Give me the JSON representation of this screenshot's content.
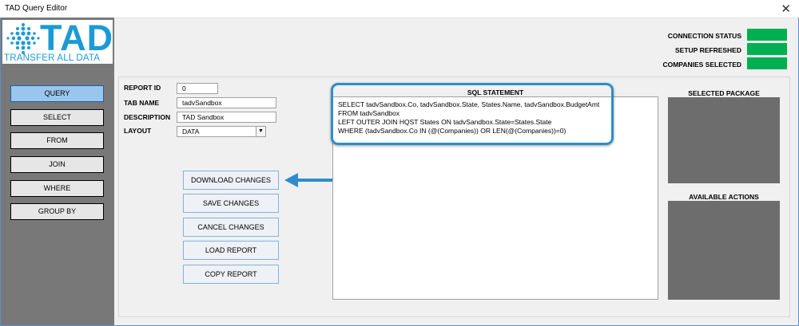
{
  "window": {
    "title": "TAD Query Editor",
    "close_glyph": "✕"
  },
  "logo": {
    "name": "TAD",
    "tagline": "TRANSFER ALL DATA",
    "brand_color": "#1c9ad6"
  },
  "nav": {
    "items": [
      {
        "label": "QUERY",
        "active": true
      },
      {
        "label": "SELECT",
        "active": false
      },
      {
        "label": "FROM",
        "active": false
      },
      {
        "label": "JOIN",
        "active": false
      },
      {
        "label": "WHERE",
        "active": false
      },
      {
        "label": "GROUP BY",
        "active": false
      }
    ]
  },
  "status": {
    "items": [
      {
        "label": "CONNECTION STATUS",
        "color": "#00b050"
      },
      {
        "label": "SETUP REFRESHED",
        "color": "#00b050"
      },
      {
        "label": "COMPANIES SELECTED",
        "color": "#00b050"
      }
    ]
  },
  "form": {
    "report_id": {
      "label": "REPORT ID",
      "value": "0"
    },
    "tab_name": {
      "label": "TAB NAME",
      "value": "tadvSandbox"
    },
    "description": {
      "label": "DESCRIPTION",
      "value": "TAD Sandbox"
    },
    "layout": {
      "label": "LAYOUT",
      "value": "DATA"
    }
  },
  "actions": {
    "download": "DOWNLOAD CHANGES",
    "save": "SAVE CHANGES",
    "cancel": "CANCEL CHANGES",
    "load": "LOAD REPORT",
    "copy": "COPY REPORT"
  },
  "sql": {
    "label": "SQL STATEMENT",
    "lines": [
      "SELECT tadvSandbox.Co, tadvSandbox.State, States.Name, tadvSandbox.BudgetAmt",
      "FROM tadvSandbox",
      "LEFT OUTER JOIN HQST States ON tadvSandbox.State=States.State",
      "WHERE (tadvSandbox.Co IN (@(Companies)) OR LEN(@(Companies))=0)"
    ]
  },
  "right_panels": {
    "selected_package": "SELECTED PACKAGE",
    "available_actions": "AVAILABLE ACTIONS"
  },
  "colors": {
    "left_panel": "#787878",
    "active_nav": "#9ac6ee",
    "status_ok": "#00b050",
    "highlight": "#2f8ccd",
    "dark_panel": "#6d6d6d"
  }
}
